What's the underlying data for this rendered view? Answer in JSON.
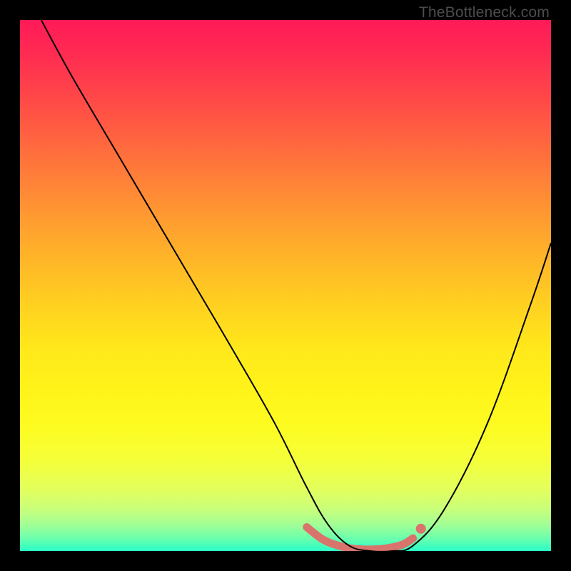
{
  "watermark": "TheBottleneck.com",
  "chart_data": {
    "type": "line",
    "title": "",
    "xlabel": "",
    "ylabel": "",
    "xlim": [
      0,
      100
    ],
    "ylim": [
      0,
      100
    ],
    "series": [
      {
        "name": "bottleneck-curve",
        "x": [
          4,
          10,
          20,
          30,
          40,
          48,
          54,
          58,
          62,
          66,
          70,
          74,
          80,
          88,
          96,
          100
        ],
        "y": [
          100,
          89,
          72,
          55,
          38,
          24,
          12,
          5,
          1,
          0,
          0,
          1,
          8,
          24,
          46,
          58
        ],
        "stroke": "#000000",
        "stroke_width": 2
      },
      {
        "name": "highlight-flat-region",
        "x": [
          54,
          57,
          60,
          63,
          66,
          69,
          72,
          74
        ],
        "y": [
          4.5,
          2.2,
          1.0,
          0.4,
          0.3,
          0.5,
          1.2,
          2.4
        ],
        "stroke": "#d9746c",
        "stroke_width": 11,
        "linecap": "round"
      },
      {
        "name": "highlight-end-dot",
        "type_hint": "marker",
        "x": [
          75.5
        ],
        "y": [
          4.2
        ],
        "fill": "#d9746c",
        "radius": 7
      }
    ],
    "background": {
      "type": "vertical-gradient",
      "stops": [
        {
          "pos": 0.0,
          "color": "#ff1a58"
        },
        {
          "pos": 0.24,
          "color": "#ff6a3e"
        },
        {
          "pos": 0.54,
          "color": "#ffd220"
        },
        {
          "pos": 0.77,
          "color": "#fdfc22"
        },
        {
          "pos": 0.92,
          "color": "#caff7a"
        },
        {
          "pos": 1.0,
          "color": "#2affc6"
        }
      ]
    }
  }
}
